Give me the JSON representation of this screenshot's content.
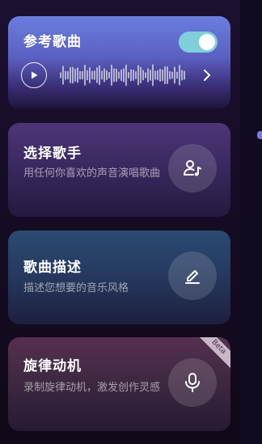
{
  "reference_song": {
    "title": "参考歌曲",
    "toggle_on": true,
    "play_icon": "play-icon",
    "chevron_icon": "chevron-right-icon"
  },
  "select_singer": {
    "title": "选择歌手",
    "subtitle": "用任何你喜欢的声音演唱歌曲",
    "icon": "singer-music-icon"
  },
  "song_description": {
    "title": "歌曲描述",
    "subtitle": "描述您想要的音乐风格",
    "icon": "edit-pen-icon"
  },
  "melody": {
    "title": "旋律动机",
    "subtitle": "录制旋律动机，激发创作灵感",
    "badge": "Beta",
    "icon": "microphone-icon"
  },
  "colors": {
    "toggle_active": "#7fd0d8",
    "accent_dot": "#6f7ee6"
  }
}
